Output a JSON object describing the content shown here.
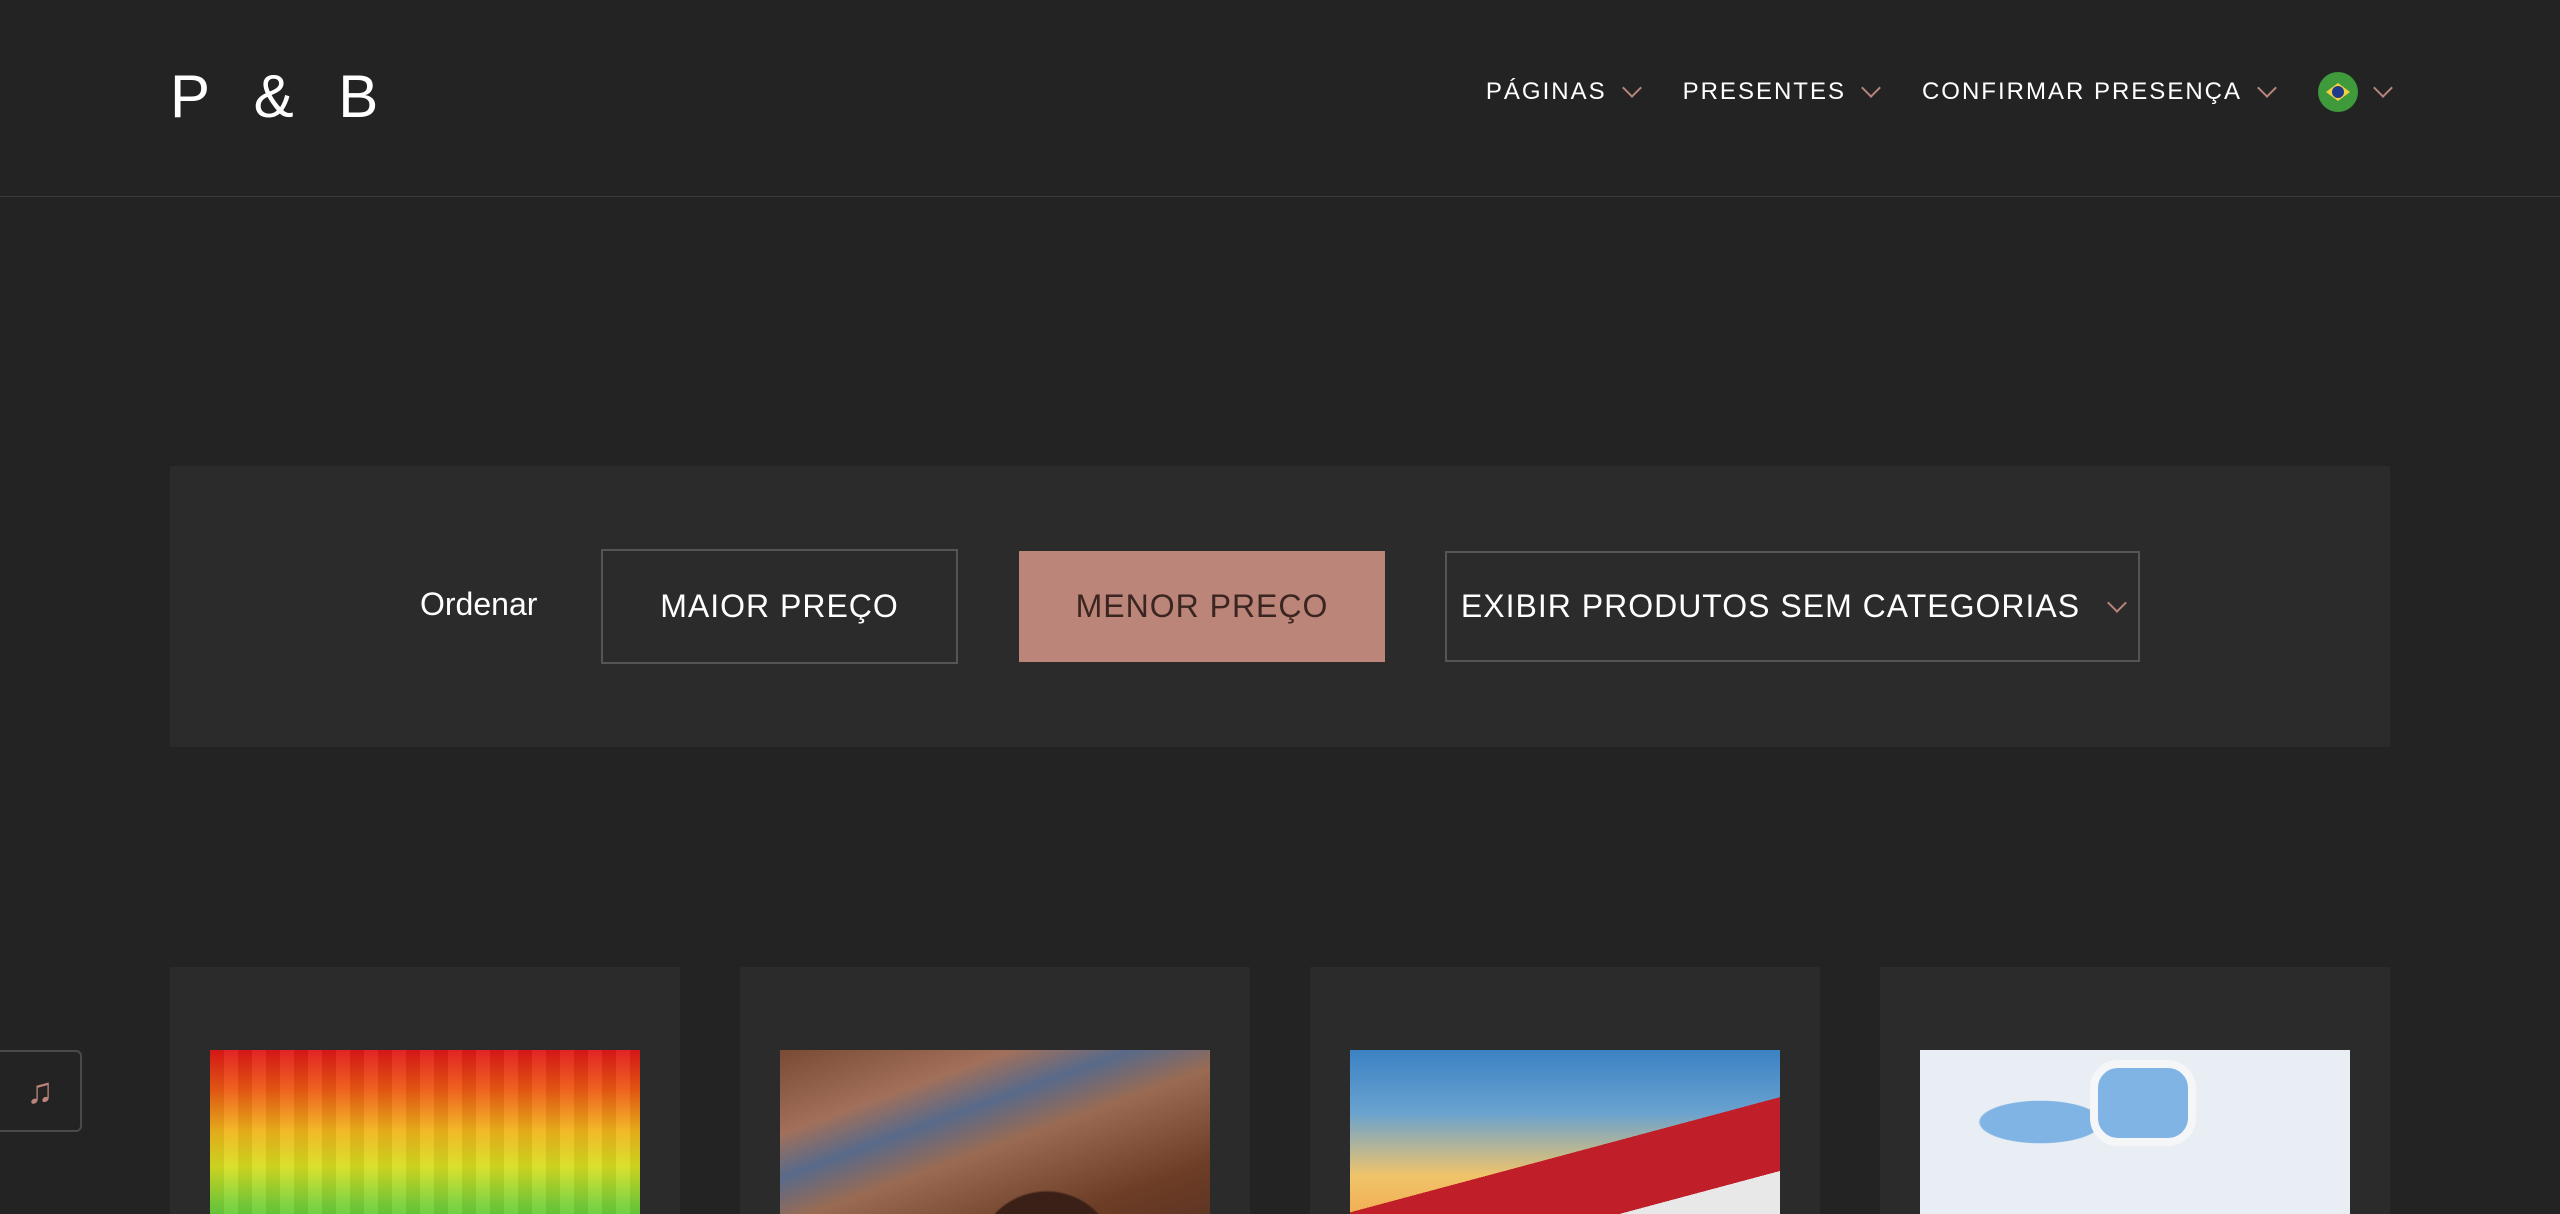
{
  "header": {
    "logo": "P & B",
    "nav": [
      {
        "label": "PÁGINAS"
      },
      {
        "label": "PRESENTES"
      },
      {
        "label": "CONFIRMAR PRESENÇA"
      }
    ],
    "language_icon": "brazil-flag-icon"
  },
  "filters": {
    "order_label": "Ordenar",
    "max_price": "MAIOR PREÇO",
    "min_price": "MENOR PREÇO",
    "category": "EXIBIR PRODUTOS SEM CATEGORIAS",
    "active": "min_price"
  },
  "products": [
    {
      "image": "rainbow-pattern-image"
    },
    {
      "image": "chocolate-dessert-image"
    },
    {
      "image": "red-train-image"
    },
    {
      "image": "airplane-cabin-image"
    }
  ],
  "music_icon": "music-note-icon",
  "colors": {
    "accent": "#bb857a",
    "background": "#232323",
    "panel": "#2b2b2b"
  }
}
